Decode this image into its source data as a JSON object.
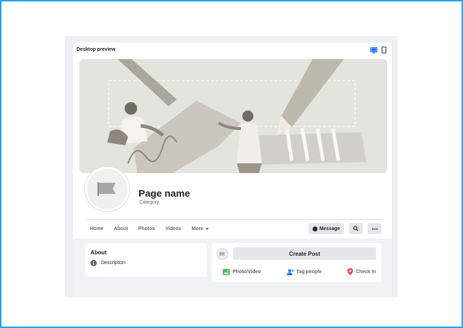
{
  "preview": {
    "title": "Desktop preview",
    "device_icons": [
      "desktop-icon",
      "mobile-icon"
    ],
    "active_color": "#1877f2"
  },
  "page": {
    "name": "Page name",
    "category": "Category"
  },
  "nav": {
    "items": [
      "Home",
      "About",
      "Photos",
      "Videos"
    ],
    "more_label": "More"
  },
  "actions": {
    "message_label": "Message"
  },
  "about": {
    "title": "About",
    "description": "Description"
  },
  "composer": {
    "create_post_label": "Create Post",
    "photo_video_label": "Photo/Video",
    "tag_people_label": "Tag people",
    "check_in_label": "Check In"
  },
  "colors": {
    "frame_border": "#1aa3e8",
    "photo_green": "#45bd62",
    "tag_blue": "#1877f2",
    "checkin_red": "#f3425f"
  }
}
